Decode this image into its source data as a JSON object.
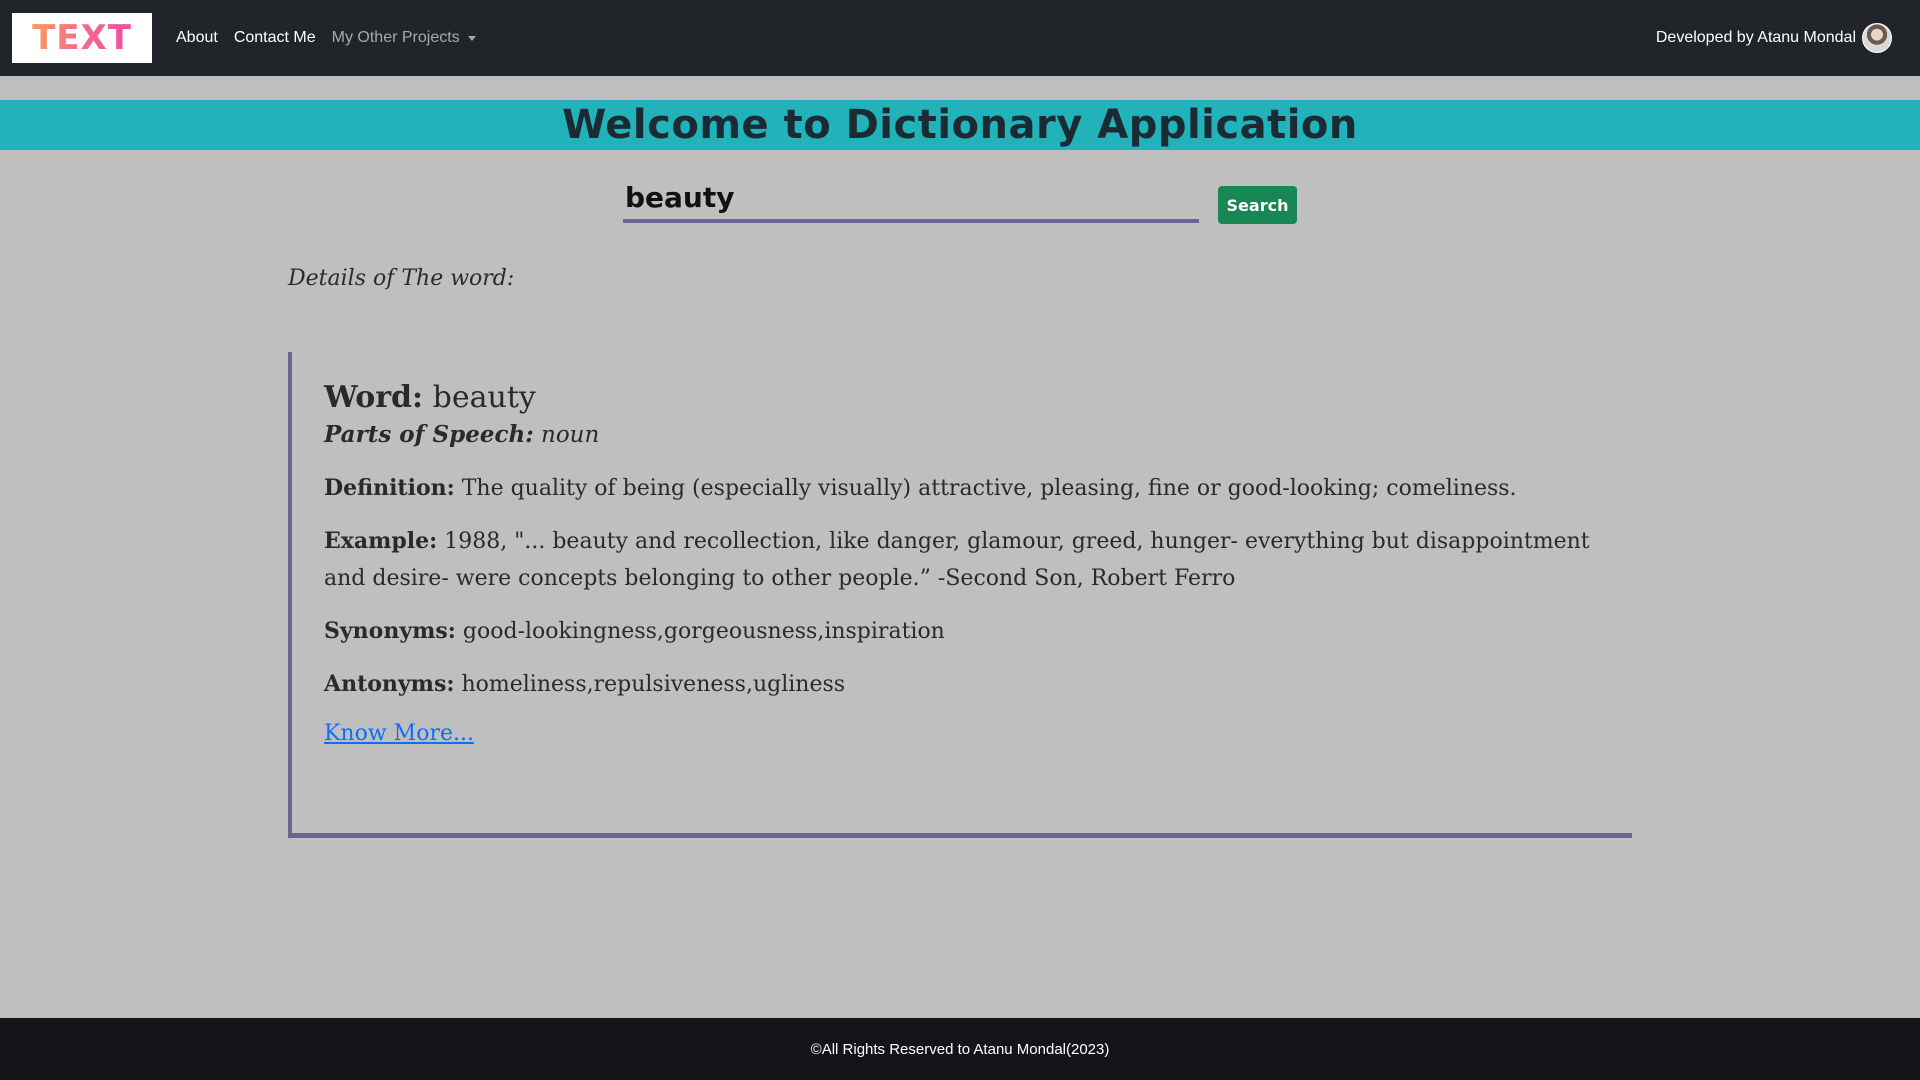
{
  "navbar": {
    "brand_text": "TEXT",
    "links": [
      "About",
      "Contact Me"
    ],
    "dropdown_label": "My Other Projects",
    "developer_text": "Developed by Atanu Mondal"
  },
  "banner": {
    "title": "Welcome to Dictionary Application"
  },
  "search": {
    "value": "beauty",
    "button_label": "Search"
  },
  "details_heading": "Details of The word:",
  "result": {
    "word_label": "Word:",
    "word": "beauty",
    "pos_label": "Parts of Speech:",
    "pos": "noun",
    "definition_label": "Definition:",
    "definition": "The quality of being (especially visually) attractive, pleasing, fine or good-looking; comeliness.",
    "example_label": "Example:",
    "example": "1988, \"... beauty and recollection, like danger, glamour, greed, hunger- everything but disappointment and desire- were concepts belonging to other people.” -Second Son, Robert Ferro",
    "synonyms_label": "Synonyms:",
    "synonyms": "good-lookingness,gorgeousness,inspiration",
    "antonyms_label": "Antonyms:",
    "antonyms": "homeliness,repulsiveness,ugliness",
    "know_more": "Know More..."
  },
  "footer": {
    "text": "©All Rights Reserved to Atanu Mondal(2023)"
  },
  "colors": {
    "navbar_bg": "#212529",
    "banner_bg": "#22b2b9",
    "page_bg": "#bfbfbf",
    "accent_border": "#67678f",
    "search_button": "#198754",
    "link": "#0d6efd",
    "footer_bg": "#131519"
  },
  "icons": {
    "dropdown": "caret-down-icon",
    "developer": "avatar-image"
  }
}
